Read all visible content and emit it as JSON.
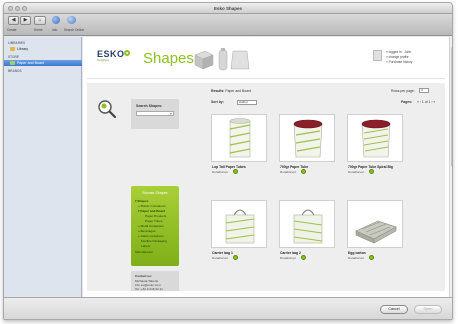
{
  "window": {
    "title": "Esko Shapes"
  },
  "toolbar": {
    "buttons": [
      {
        "label": "Create"
      },
      {
        "label": "Home"
      },
      {
        "label": "Info"
      },
      {
        "label": "Search Online"
      }
    ]
  },
  "sidebar": {
    "sections": [
      {
        "heading": "LIBRARIES",
        "items": [
          {
            "label": "Library"
          }
        ]
      },
      {
        "heading": "STORE",
        "items": [
          {
            "label": "Paper and Board"
          }
        ]
      },
      {
        "heading": "BRANDS",
        "items": []
      }
    ]
  },
  "header": {
    "logo_text": "ESKO",
    "logo_tagline": "Graphics",
    "brand_title": "Shapes",
    "user_lines": [
      "» logged in : John",
      "» change profile",
      "» Purchase history"
    ]
  },
  "search_panel": {
    "title": "Search Shapes:",
    "query": "",
    "go_glyph": "»"
  },
  "browse_panel": {
    "title": "Browse Shapes",
    "tree": [
      {
        "label": "▾ Shapes",
        "level": 0,
        "bold": true
      },
      {
        "label": "» Plastic Containers",
        "level": 1,
        "bold": false
      },
      {
        "label": "▾ Paper and Board",
        "level": 1,
        "bold": true
      },
      {
        "label": "Paper Products",
        "level": 2,
        "bold": false
      },
      {
        "label": "Paper Tubes",
        "level": 2,
        "bold": false
      },
      {
        "label": "» Metal Containers",
        "level": 1,
        "bold": false
      },
      {
        "label": "» Beverages",
        "level": 1,
        "bold": false
      },
      {
        "label": "» Glass containers",
        "level": 1,
        "bold": false
      },
      {
        "label": "Flexible Packaging",
        "level": 1,
        "bold": false
      },
      {
        "label": "Labels",
        "level": 1,
        "bold": false
      },
      {
        "label": "Manufacturer",
        "level": 0,
        "bold": false
      }
    ]
  },
  "contact_panel": {
    "title": "Contact us:",
    "lines": [
      "Michaela Taberle",
      "info.eu@esko.com",
      "Tel: +32 9 216 92 11"
    ]
  },
  "results": {
    "label": "Results:",
    "query_text": "Paper and Board",
    "sort_label": "Sort by:",
    "sort_value": "Author",
    "rows_label": "Rows per page:",
    "rows_value": "3",
    "pages_label": "Pages:",
    "pages_nav": "« ‹ 1 of 1 › »"
  },
  "products": [
    {
      "name": "Lop Tall Paper Tubes",
      "vendor": "Rotadisrupt"
    },
    {
      "name": "700gr Paper Tube",
      "vendor": "Rotadisrupt"
    },
    {
      "name": "700gr Paper Tube Spiral Big",
      "vendor": "Rotadisrupt"
    },
    {
      "name": "Carrier bag 1",
      "vendor": "Rotadisrupt"
    },
    {
      "name": "Carrier bag 2",
      "vendor": "Rotadisrupt"
    },
    {
      "name": "Egg carton",
      "vendor": "Rotadisrupt"
    }
  ],
  "footer": {
    "cancel_label": "Cancel",
    "open_label": "Open"
  },
  "colors": {
    "accent_green": "#8dc21f",
    "selection_blue": "#3b78d1",
    "brand_navy": "#2a3d6e"
  }
}
